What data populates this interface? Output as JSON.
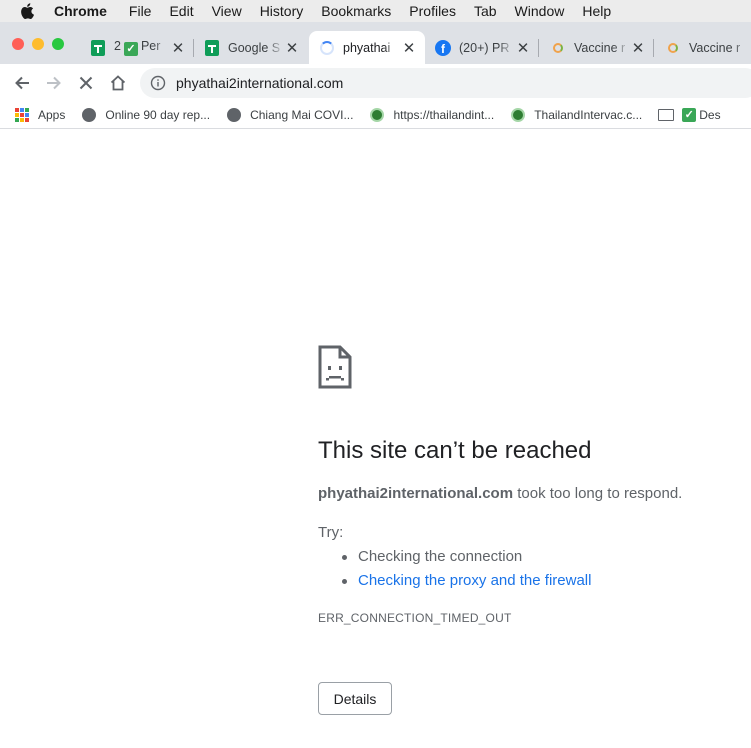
{
  "menubar": {
    "app": "Chrome",
    "items": [
      "File",
      "Edit",
      "View",
      "History",
      "Bookmarks",
      "Profiles",
      "Tab",
      "Window",
      "Help"
    ]
  },
  "tabs": [
    {
      "icon": "google-sheets-icon",
      "prefix": "2",
      "title": "Per",
      "has_check": true
    },
    {
      "icon": "google-sheets-icon",
      "title": "Google S"
    },
    {
      "icon": "loading-spinner-icon",
      "title": "phyathai",
      "active": true
    },
    {
      "icon": "facebook-icon",
      "title": "(20+) PR"
    },
    {
      "icon": "vaccine-site-icon",
      "title": "Vaccine r"
    },
    {
      "icon": "vaccine-site-icon",
      "title": "Vaccine r"
    }
  ],
  "omnibox": {
    "url": "phyathai2international.com"
  },
  "bookmarks": [
    {
      "icon": "apps-grid-icon",
      "label": "Apps"
    },
    {
      "icon": "globe-icon",
      "label": "Online 90 day rep..."
    },
    {
      "icon": "globe-icon",
      "label": "Chiang Mai  COVI..."
    },
    {
      "icon": "thai-site-icon",
      "label": "https://thailandint..."
    },
    {
      "icon": "thai-site-icon",
      "label": "ThailandIntervac.c..."
    },
    {
      "icon": "folder-icon",
      "label": "Des",
      "has_check": true
    }
  ],
  "error": {
    "title": "This site can’t be reached",
    "host": "phyathai2international.com",
    "message": " took too long to respond.",
    "try_label": "Try:",
    "suggestions": [
      "Checking the connection",
      "Checking the proxy and the firewall"
    ],
    "code": "ERR_CONNECTION_TIMED_OUT",
    "details_button": "Details"
  },
  "colors": {
    "link": "#1a73e8",
    "text_secondary": "#5f6368",
    "tabstrip": "#dee1e6",
    "close_red": "#ff5f57",
    "minimize_yellow": "#febc2e",
    "zoom_green": "#28c840"
  }
}
